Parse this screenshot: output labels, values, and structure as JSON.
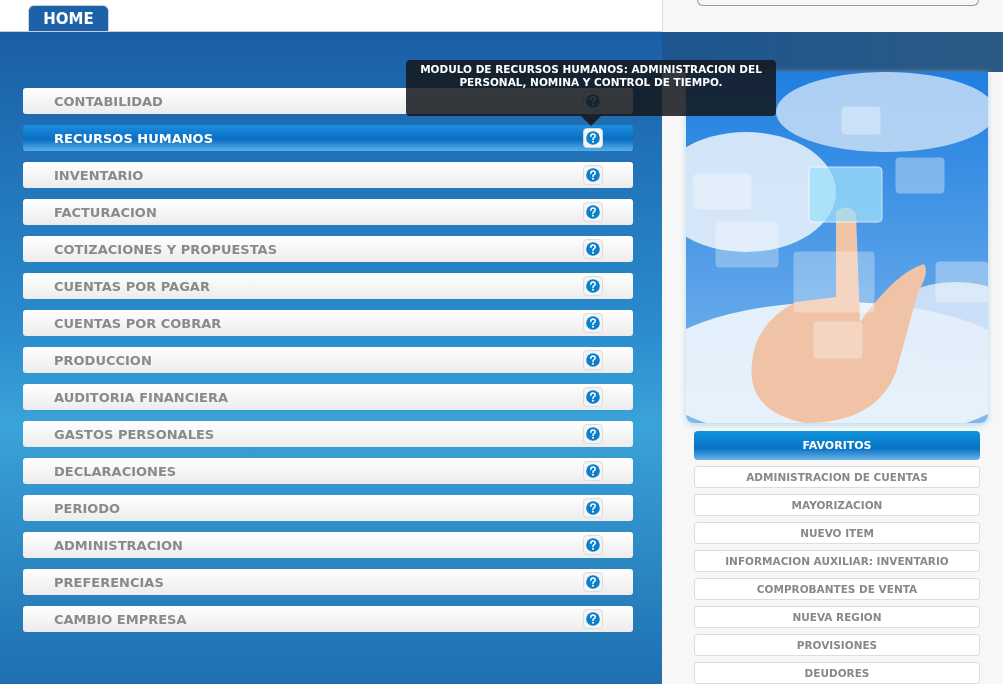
{
  "tabs": [
    {
      "label": "HOME",
      "selected": true
    }
  ],
  "modules": [
    {
      "label": "CONTABILIDAD",
      "selected": false
    },
    {
      "label": "RECURSOS HUMANOS",
      "selected": true
    },
    {
      "label": "INVENTARIO",
      "selected": false
    },
    {
      "label": "FACTURACION",
      "selected": false
    },
    {
      "label": "COTIZACIONES Y PROPUESTAS",
      "selected": false
    },
    {
      "label": "CUENTAS POR PAGAR",
      "selected": false
    },
    {
      "label": "CUENTAS POR COBRAR",
      "selected": false
    },
    {
      "label": "PRODUCCION",
      "selected": false
    },
    {
      "label": "AUDITORIA FINANCIERA",
      "selected": false
    },
    {
      "label": "GASTOS PERSONALES",
      "selected": false
    },
    {
      "label": "DECLARACIONES",
      "selected": false
    },
    {
      "label": "PERIODO",
      "selected": false
    },
    {
      "label": "ADMINISTRACION",
      "selected": false
    },
    {
      "label": "PREFERENCIAS",
      "selected": false
    },
    {
      "label": "CAMBIO EMPRESA",
      "selected": false
    }
  ],
  "tooltip": {
    "text": "MODULO DE RECURSOS HUMANOS: ADMINISTRACION DEL PERSONAL, NOMINA Y CONTROL DE TIEMPO."
  },
  "favorites": {
    "title": "FAVORITOS",
    "items": [
      "ADMINISTRACION DE CUENTAS",
      "MAYORIZACION",
      "NUEVO ITEM",
      "INFORMACION AUXILIAR: INVENTARIO",
      "COMPROBANTES DE VENTA",
      "NUEVA REGION",
      "PROVISIONES",
      "DEUDORES"
    ]
  }
}
